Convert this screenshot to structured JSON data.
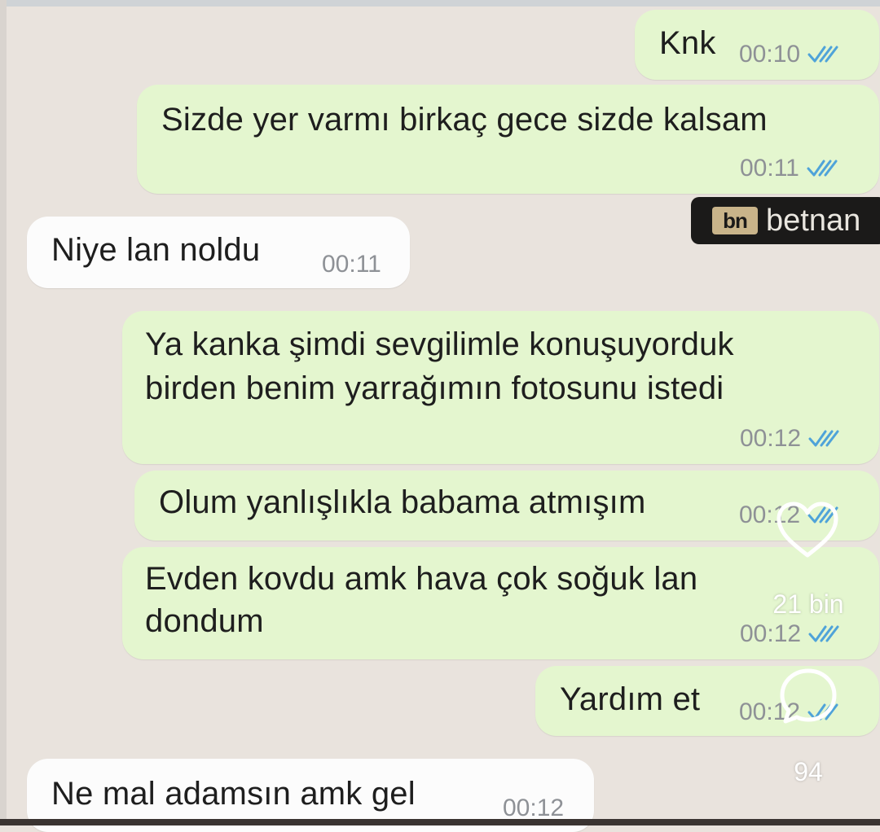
{
  "messages": [
    {
      "text": "Knk",
      "time": "00:10",
      "dir": "out"
    },
    {
      "text": "Sizde yer varmı birkaç gece sizde kalsam",
      "time": "00:11",
      "dir": "out"
    },
    {
      "text": "Niye lan noldu",
      "time": "00:11",
      "dir": "in"
    },
    {
      "text1": "Ya kanka şimdi sevgilimle konuşuyorduk",
      "text2": "birden benim yarrağımın fotosunu istedi",
      "time": "00:12",
      "dir": "out"
    },
    {
      "text": "Olum yanlışlıkla babama atmışım",
      "time": "00:12",
      "dir": "out"
    },
    {
      "text1": "Evden kovdu amk hava çok soğuk lan",
      "text2": "dondum",
      "time": "00:12",
      "dir": "out"
    },
    {
      "text": "Yardım et",
      "time": "00:12",
      "dir": "out"
    },
    {
      "text": "Ne mal adamsın amk gel",
      "time": "00:12",
      "dir": "in"
    }
  ],
  "watermark": {
    "mark": "bn",
    "name": "betnan"
  },
  "overlay": {
    "likes": "21 bin",
    "comments": "94",
    "like_icon": "heart-icon",
    "comment_icon": "comment-icon"
  },
  "colors": {
    "outgoing": "#e4f6cf",
    "incoming": "#fcfcfc",
    "background": "#e9e3dd",
    "tick": "#4fa3d9"
  }
}
